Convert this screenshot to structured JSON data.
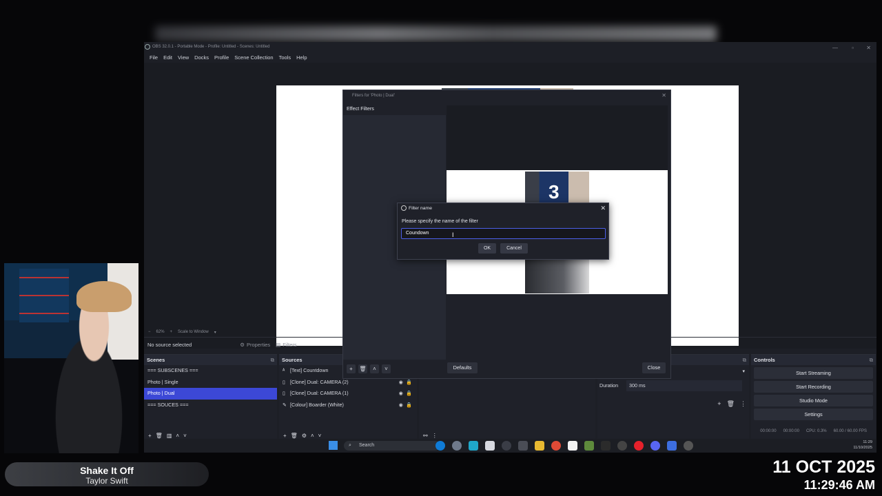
{
  "obs": {
    "window_title": "OBS 32.0.1 - Portable Mode - Profile: Untitled - Scenes: Untitled",
    "menu": [
      "File",
      "Edit",
      "View",
      "Docks",
      "Profile",
      "Scene Collection",
      "Tools",
      "Help"
    ],
    "zoom_text": "62%",
    "scale_label": "Scale to Window",
    "no_source": "No source selected",
    "properties_label": "Properties",
    "filters_label": "Filters",
    "scenes": {
      "title": "Scenes",
      "items": [
        "=== SUBSCENES ===",
        "Photo | Single",
        "Photo | Dual",
        "=== SOUCES ==="
      ],
      "selected_index": 2
    },
    "sources": {
      "title": "Sources",
      "items": [
        {
          "label": "[Text] Countdown",
          "icon": "text-icon"
        },
        {
          "label": "[Clone] Dual: CAMERA (2)",
          "icon": "file-icon"
        },
        {
          "label": "[Clone] Dual: CAMERA (1)",
          "icon": "file-icon"
        },
        {
          "label": "[Colour] Boarder (White)",
          "icon": "brush-icon"
        }
      ]
    },
    "transitions": {
      "duration_label": "Duration",
      "duration_value": "300 ms"
    },
    "controls": {
      "title": "Controls",
      "buttons": [
        "Start Streaming",
        "Start Recording",
        "Studio Mode",
        "Settings"
      ]
    },
    "status": {
      "stream_time": "00:00:00",
      "rec_time": "00:00:00",
      "cpu": "CPU: 0.3%",
      "fps": "60.00 / 60.00 FPS"
    }
  },
  "filters_dialog": {
    "title": "Filters for 'Photo | Dual'",
    "effect_filters_label": "Effect Filters",
    "preview_number": "3",
    "defaults_label": "Defaults",
    "close_label": "Close"
  },
  "filter_name_dialog": {
    "title": "Filter name",
    "prompt": "Please specify the name of the filter",
    "input_value": "Coundown",
    "ok_label": "OK",
    "cancel_label": "Cancel"
  },
  "taskbar": {
    "search_placeholder": "Search",
    "tray_time": "11:29",
    "tray_date": "11/10/2025"
  },
  "overlay": {
    "song_title": "Shake It Off",
    "song_artist": "Taylor Swift",
    "date": "11 OCT 2025",
    "time": "11:29:46 AM"
  },
  "colors": {
    "accent": "#3c48d6",
    "panel": "#1f2129",
    "background": "#060608"
  }
}
